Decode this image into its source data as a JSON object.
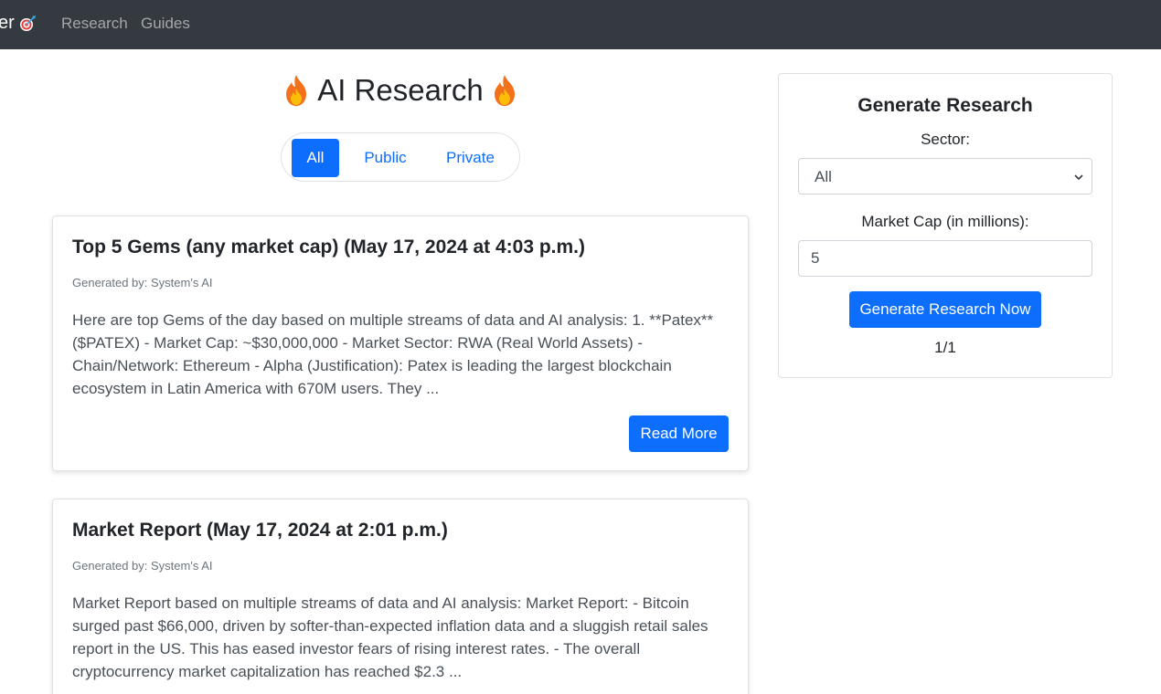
{
  "navbar": {
    "brand_text": "er",
    "brand_icon": "target-dart-icon",
    "links": [
      "Research",
      "Guides"
    ]
  },
  "page": {
    "title": "AI Research",
    "title_icon": "fire-icon"
  },
  "filter": {
    "options": [
      "All",
      "Public",
      "Private"
    ],
    "selected": "All"
  },
  "cards": [
    {
      "title": "Top 5 Gems (any market cap) (May 17, 2024 at 4:03 p.m.)",
      "meta": "Generated by: System's AI",
      "text": "Here are top Gems of the day based on multiple streams of data and AI analysis: 1. **Patex** ($PATEX) - Market Cap: ~$30,000,000 - Market Sector: RWA (Real World Assets) - Chain/Network: Ethereum - Alpha (Justification): Patex is leading the largest blockchain ecosystem in Latin America with 670M users. They ...",
      "button": "Read More"
    },
    {
      "title": "Market Report (May 17, 2024 at 2:01 p.m.)",
      "meta": "Generated by: System's AI",
      "text": "Market Report based on multiple streams of data and AI analysis: Market Report: - Bitcoin surged past $66,000, driven by softer-than-expected inflation data and a sluggish retail sales report in the US. This has eased investor fears of rising interest rates. - The overall cryptocurrency market capitalization has reached $2.3 ..."
    }
  ],
  "sidebar": {
    "title": "Generate Research",
    "sector_label": "Sector:",
    "sector_value": "All",
    "market_cap_label": "Market Cap (in millions):",
    "market_cap_value": "5",
    "button": "Generate Research Now",
    "counter": "1/1"
  },
  "colors": {
    "navbar": "#343a40",
    "primary": "#0d6efd"
  }
}
